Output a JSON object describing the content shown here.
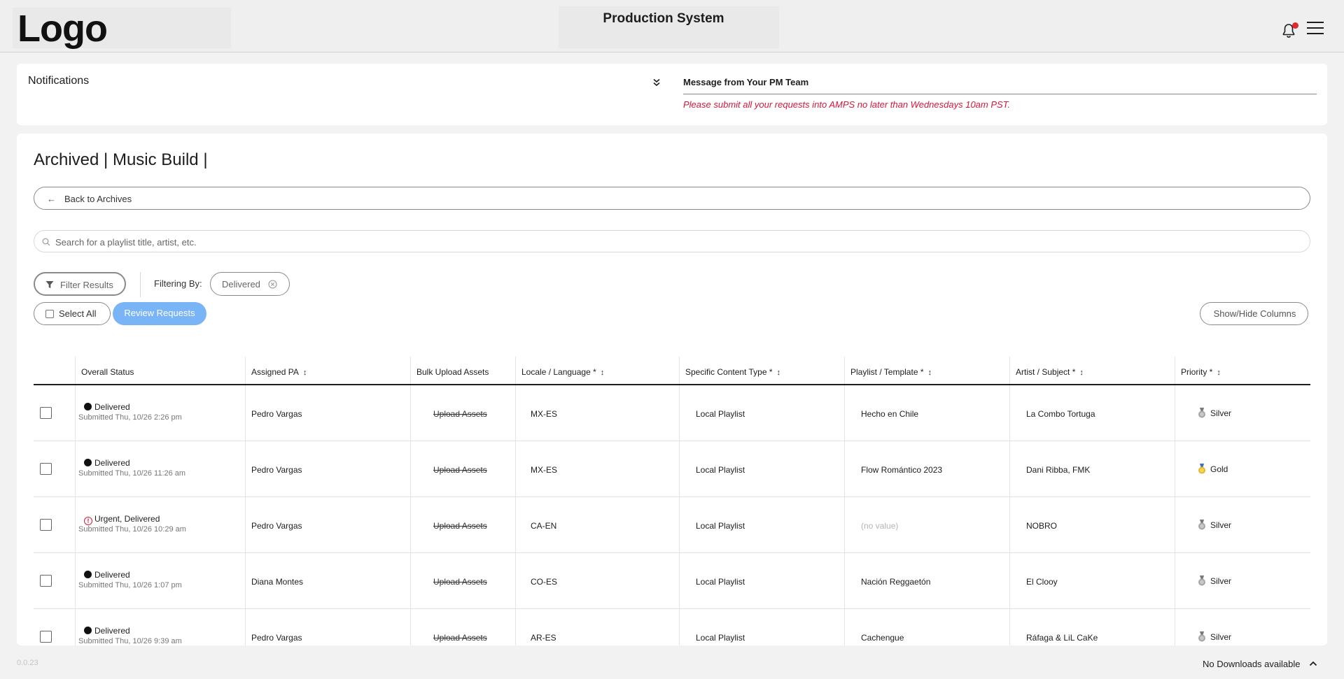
{
  "header": {
    "logo": "Logo",
    "app_title": "Production System"
  },
  "notifications": {
    "title": "Notifications",
    "message_title": "Message from Your PM Team",
    "message_text": "Please submit all your requests into AMPS no later than Wednesdays 10am PST."
  },
  "page": {
    "title": "Archived | Music Build |",
    "back_label": "Back to Archives",
    "search_placeholder": "Search for a playlist title, artist, etc.",
    "filter_label": "Filter Results",
    "filtering_by_label": "Filtering By:",
    "active_filter": "Delivered",
    "select_all_label": "Select All",
    "review_label": "Review Requests",
    "show_hide_label": "Show/Hide Columns"
  },
  "table": {
    "columns": [
      {
        "label": "Overall Status",
        "sortable": false
      },
      {
        "label": "Assigned PA",
        "sortable": true
      },
      {
        "label": "Bulk Upload Assets",
        "sortable": false
      },
      {
        "label": "Locale / Language *",
        "sortable": true
      },
      {
        "label": "Specific Content Type *",
        "sortable": true
      },
      {
        "label": "Playlist / Template *",
        "sortable": true
      },
      {
        "label": "Artist / Subject *",
        "sortable": true
      },
      {
        "label": "Priority *",
        "sortable": true
      }
    ],
    "sort_glyph": "↕",
    "rows": [
      {
        "status": "Delivered",
        "urgent": false,
        "submitted": "Submitted Thu, 10/26 2:26 pm",
        "pa": "Pedro Vargas",
        "upload": "Upload Assets",
        "locale": "MX-ES",
        "content_type": "Local Playlist",
        "playlist": "Hecho en Chile",
        "artist": "La Combo Tortuga",
        "priority": "Silver"
      },
      {
        "status": "Delivered",
        "urgent": false,
        "submitted": "Submitted Thu, 10/26 11:26 am",
        "pa": "Pedro Vargas",
        "upload": "Upload Assets",
        "locale": "MX-ES",
        "content_type": "Local Playlist",
        "playlist": "Flow Romántico 2023",
        "artist": "Dani Ribba, FMK",
        "priority": "Gold"
      },
      {
        "status": "Urgent, Delivered",
        "urgent": true,
        "submitted": "Submitted Thu, 10/26 10:29 am",
        "pa": "Pedro Vargas",
        "upload": "Upload Assets",
        "locale": "CA-EN",
        "content_type": "Local Playlist",
        "playlist": "(no value)",
        "artist": "NOBRO",
        "priority": "Silver"
      },
      {
        "status": "Delivered",
        "urgent": false,
        "submitted": "Submitted Thu, 10/26 1:07 pm",
        "pa": "Diana Montes",
        "upload": "Upload Assets",
        "locale": "CO-ES",
        "content_type": "Local Playlist",
        "playlist": "Nación Reggaetón",
        "artist": "El Clooy",
        "priority": "Silver"
      },
      {
        "status": "Delivered",
        "urgent": false,
        "submitted": "Submitted Thu, 10/26 9:39 am",
        "pa": "Pedro Vargas",
        "upload": "Upload Assets",
        "locale": "AR-ES",
        "content_type": "Local Playlist",
        "playlist": "Cachengue",
        "artist": "Ráfaga & LiL CaKe",
        "priority": "Silver"
      }
    ]
  },
  "footer": {
    "version": "0.0.23",
    "downloads": "No Downloads available"
  },
  "colors": {
    "accent": "#79b4f6",
    "alert": "#d6173a",
    "gold": "#e3b82a",
    "silver": "#9a9a9a"
  }
}
